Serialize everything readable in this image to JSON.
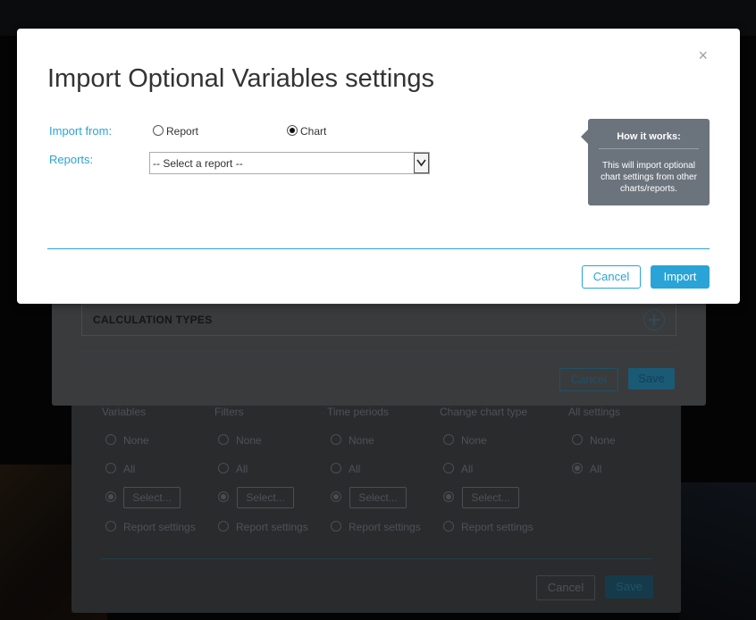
{
  "modal": {
    "title": "Import Optional Variables settings",
    "import_from_label": "Import from:",
    "options": [
      {
        "label": "Report",
        "checked": false
      },
      {
        "label": "Chart",
        "checked": true
      }
    ],
    "reports_label": "Reports:",
    "report_select_value": "-- Select a report --",
    "tooltip": {
      "title": "How it works:",
      "body": "This will import optional chart settings from other charts/reports."
    },
    "cancel_label": "Cancel",
    "import_label": "Import",
    "accent_color": "#2aa3d6"
  },
  "mid_dialog": {
    "section_label": "CALCULATION TYPES",
    "cancel_label": "Cancel",
    "save_label": "Save"
  },
  "low_dialog": {
    "columns": [
      {
        "title": "Variables",
        "options": [
          "None",
          "All",
          "Select...",
          "Report settings"
        ],
        "selected": 2
      },
      {
        "title": "Filters",
        "options": [
          "None",
          "All",
          "Select...",
          "Report settings"
        ],
        "selected": 2
      },
      {
        "title": "Time periods",
        "options": [
          "None",
          "All",
          "Select...",
          "Report settings"
        ],
        "selected": 2
      },
      {
        "title": "Change chart type",
        "options": [
          "None",
          "All",
          "Select...",
          "Report settings"
        ],
        "selected": 2
      },
      {
        "title": "All settings",
        "options": [
          "None",
          "All"
        ],
        "selected": 1
      }
    ],
    "cancel_label": "Cancel",
    "save_label": "Save"
  }
}
